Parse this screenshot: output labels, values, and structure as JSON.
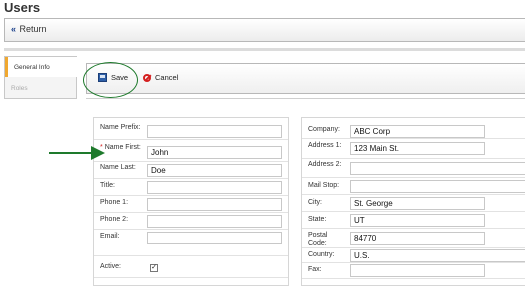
{
  "page": {
    "title": "Users"
  },
  "toolbar": {
    "return_label": "Return",
    "return_glyph": "«"
  },
  "tabs": [
    {
      "label": "General Info",
      "active": true
    },
    {
      "label": "Roles",
      "active": false
    }
  ],
  "actions": {
    "save_label": "Save",
    "cancel_label": "Cancel"
  },
  "form_left": {
    "name_prefix": {
      "label": "Name Prefix:",
      "value": ""
    },
    "name_first": {
      "label": "Name First:",
      "required_mark": "*",
      "value": "John"
    },
    "name_last": {
      "label": "Name Last:",
      "value": "Doe"
    },
    "title": {
      "label": "Title:",
      "value": ""
    },
    "phone1": {
      "label": "Phone 1:",
      "value": ""
    },
    "phone2": {
      "label": "Phone 2:",
      "value": ""
    },
    "email": {
      "label": "Email:",
      "value": ""
    },
    "active": {
      "label": "Active:",
      "checked": true,
      "check_glyph": "✓"
    }
  },
  "form_right": {
    "company": {
      "label": "Company:",
      "value": "ABC Corp"
    },
    "address1": {
      "label": "Address 1:",
      "value": "123 Main St."
    },
    "address2": {
      "label": "Address 2:",
      "value": ""
    },
    "mail_stop": {
      "label": "Mail Stop:",
      "value": ""
    },
    "city": {
      "label": "City:",
      "value": "St. George"
    },
    "state": {
      "label": "State:",
      "value": "UT"
    },
    "postal_code": {
      "label": "Postal Code:",
      "value": "84770"
    },
    "country": {
      "label": "Country:",
      "value": "U.S."
    },
    "fax": {
      "label": "Fax:",
      "value": ""
    }
  },
  "colors": {
    "annotation": "#1e7a2c",
    "required": "#d42020",
    "tab_accent": "#f0a830"
  }
}
